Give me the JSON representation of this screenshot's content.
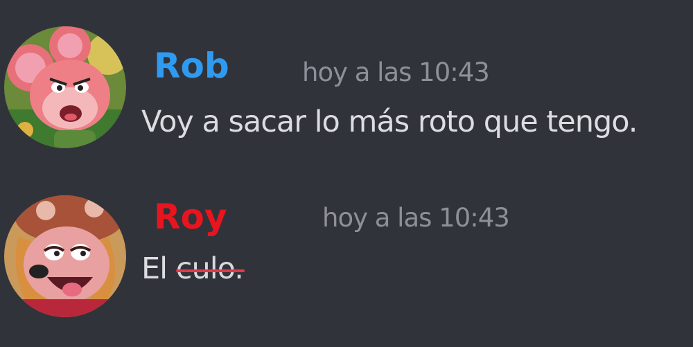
{
  "messages": [
    {
      "username": "Rob",
      "username_color": "#2f9bf0",
      "timestamp": "hoy a las 10:43",
      "text": "Voy a sacar lo más roto que tengo.",
      "avatar": "pink-mouse-avatar-icon"
    },
    {
      "username": "Roy",
      "username_color": "#e8151f",
      "timestamp": "hoy a las 10:43",
      "text": "El",
      "strikethrough_text": "culo.",
      "avatar": "smiling-mouse-avatar-icon"
    }
  ],
  "colors": {
    "background": "#31333b",
    "message_text": "#dcdde0",
    "timestamp": "#8e9097",
    "strikethrough": "#e23a48"
  }
}
